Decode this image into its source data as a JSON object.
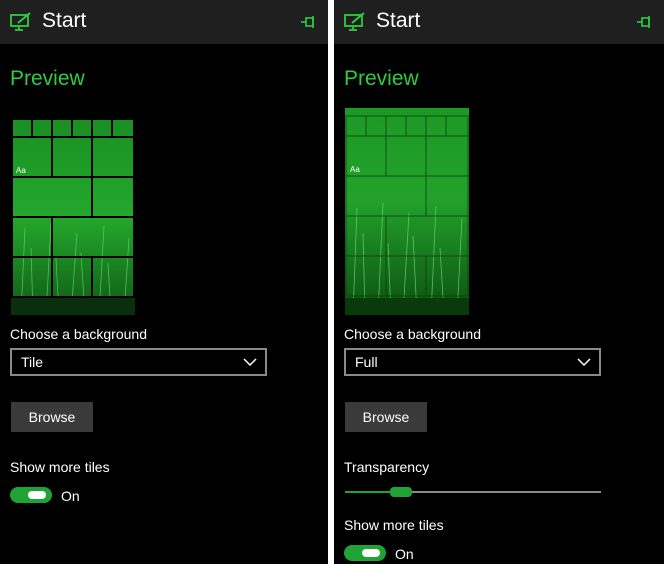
{
  "colors": {
    "accent": "#2ecc40",
    "toggle_on": "#1fa334",
    "header_bg": "#1f1f1f",
    "panel_bg": "#000000"
  },
  "left": {
    "header": {
      "title": "Start",
      "app_icon": "monitor-pen-icon",
      "pin_icon": "pin-icon"
    },
    "preview_title": "Preview",
    "preview_tile_label": "Aa",
    "background_label": "Choose a background",
    "background_value": "Tile",
    "browse_label": "Browse",
    "show_more_tiles_label": "Show more tiles",
    "toggle_state_label": "On"
  },
  "right": {
    "header": {
      "title": "Start",
      "app_icon": "monitor-pen-icon",
      "pin_icon": "pin-icon"
    },
    "preview_title": "Preview",
    "preview_tile_label": "Aa",
    "background_label": "Choose a background",
    "background_value": "Full",
    "browse_label": "Browse",
    "transparency_label": "Transparency",
    "transparency_value": 0.22,
    "show_more_tiles_label": "Show more tiles",
    "toggle_state_label": "On"
  }
}
